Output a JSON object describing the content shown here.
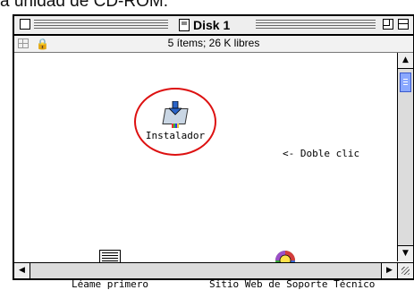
{
  "page_caption": "a unidad de CD-ROM.",
  "window": {
    "title": "Disk 1",
    "info": "5 ítems; 26 K libres"
  },
  "items": {
    "installer": "Instalador",
    "hint": "<- Doble clic",
    "readme": "Léame primero",
    "support": "Sitio Web de Soporte Técnico"
  },
  "colors": {
    "highlight_circle": "#dd1111",
    "scroll_thumb": "#8aa8ff"
  }
}
